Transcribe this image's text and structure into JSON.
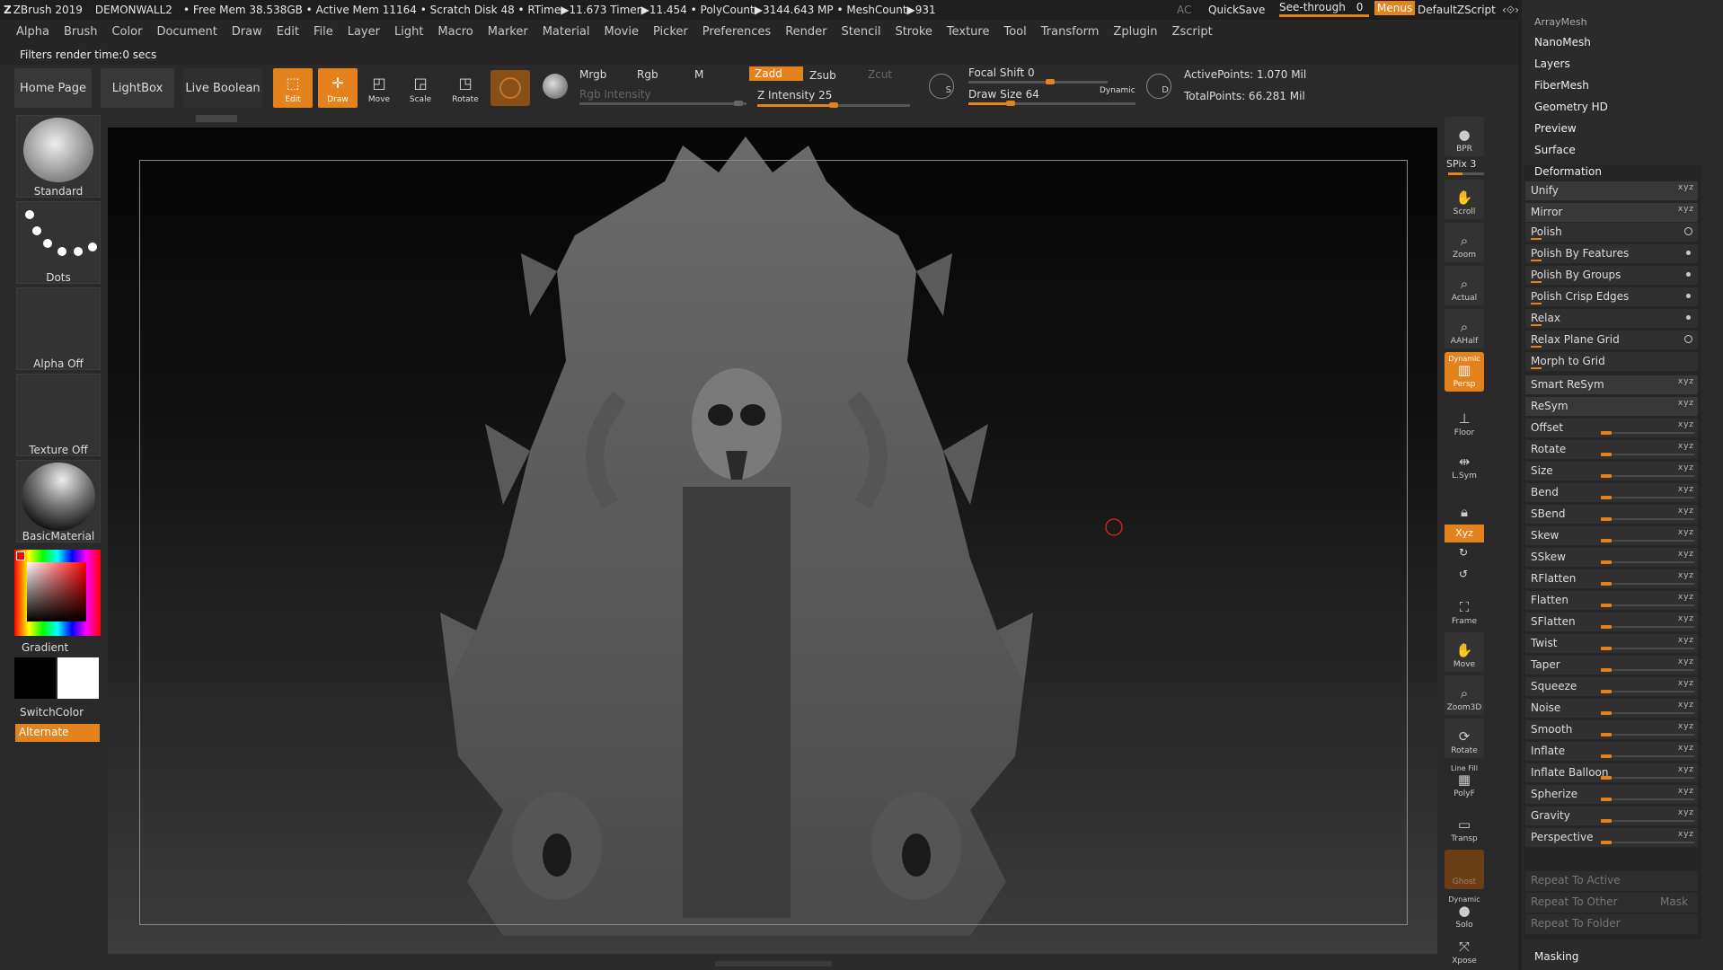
{
  "titlebar": {
    "app": "ZBrush 2019",
    "doc": "DEMONWALL2",
    "stats": "• Free Mem 38.538GB • Active Mem 11164 • Scratch Disk 48 • RTime▶11.673 Timer▶11.454 • PolyCount▶3144.643 MP • MeshCount▶931",
    "ac": "AC",
    "quicksave": "QuickSave",
    "seethrough": "See-through",
    "seethrough_value": "0",
    "menus": "Menus",
    "script": "DefaultZScript"
  },
  "menubar": [
    "Alpha",
    "Brush",
    "Color",
    "Document",
    "Draw",
    "Edit",
    "File",
    "Layer",
    "Light",
    "Macro",
    "Marker",
    "Material",
    "Movie",
    "Picker",
    "Preferences",
    "Render",
    "Stencil",
    "Stroke",
    "Texture",
    "Tool",
    "Transform",
    "Zplugin",
    "Zscript"
  ],
  "filter_status": "Filters render time:0 secs",
  "toolbar": {
    "home_page": "Home Page",
    "lightbox": "LightBox",
    "live_boolean": "Live Boolean",
    "edit": "Edit",
    "draw": "Draw",
    "move": "Move",
    "scale": "Scale",
    "rotate": "Rotate",
    "mrgb": "Mrgb",
    "rgb": "Rgb",
    "m": "M",
    "zadd": "Zadd",
    "zsub": "Zsub",
    "zcut": "Zcut",
    "rgb_intensity": "Rgb Intensity",
    "z_intensity_label": "Z Intensity",
    "z_intensity": "25",
    "focal_shift_label": "Focal Shift",
    "focal_shift": "0",
    "draw_size_label": "Draw Size",
    "draw_size": "64",
    "dynamic": "Dynamic",
    "active_points": "ActivePoints: 1.070 Mil",
    "total_points": "TotalPoints: 66.281 Mil",
    "s_label": "S",
    "d_label": "D"
  },
  "left_shelf": {
    "brush": "Standard",
    "stroke": "Dots",
    "alpha": "Alpha Off",
    "texture": "Texture Off",
    "material": "BasicMaterial",
    "gradient": "Gradient",
    "switchcolor": "SwitchColor",
    "alternate": "Alternate",
    "primary_color": "#ff0000",
    "main_color": "#000000",
    "secondary_color": "#ffffff"
  },
  "right_shelf": {
    "bpr": "BPR",
    "spix": "SPix 3",
    "scroll": "Scroll",
    "zoom": "Zoom",
    "actual": "Actual",
    "aahalf": "AAHalf",
    "persp_top": "Dynamic",
    "persp": "Persp",
    "floor": "Floor",
    "lsym": "L.Sym",
    "xyz": "Xyz",
    "frame": "Frame",
    "move": "Move",
    "zoom3d": "Zoom3D",
    "rotate": "Rotate",
    "linefill": "Line Fill",
    "polyf": "PolyF",
    "transp": "Transp",
    "ghost": "Ghost",
    "solo_top": "Dynamic",
    "solo": "Solo",
    "xpose": "Xpose"
  },
  "tray": {
    "top_cut": "ArrayMesh",
    "sections": [
      "NanoMesh",
      "Layers",
      "FiberMesh",
      "Geometry HD",
      "Preview",
      "Surface"
    ],
    "deformation": "Deformation",
    "rows": [
      {
        "name": "Unify",
        "kind": "xyz"
      },
      {
        "name": "Mirror",
        "kind": "xyz"
      },
      {
        "name": "Polish",
        "kind": "circle"
      },
      {
        "name": "Polish By Features",
        "kind": "dot"
      },
      {
        "name": "Polish By Groups",
        "kind": "dot"
      },
      {
        "name": "Polish Crisp Edges",
        "kind": "dot"
      },
      {
        "name": "Relax",
        "kind": "dot"
      },
      {
        "name": "Relax Plane Grid",
        "kind": "circle"
      },
      {
        "name": "Morph to Grid",
        "kind": "none"
      },
      {
        "name": "Smart ReSym",
        "kind": "xyz"
      },
      {
        "name": "ReSym",
        "kind": "xyz"
      },
      {
        "name": "Offset",
        "kind": "slider"
      },
      {
        "name": "Rotate",
        "kind": "slider"
      },
      {
        "name": "Size",
        "kind": "slider"
      },
      {
        "name": "Bend",
        "kind": "slider"
      },
      {
        "name": "SBend",
        "kind": "slider"
      },
      {
        "name": "Skew",
        "kind": "slider"
      },
      {
        "name": "SSkew",
        "kind": "slider"
      },
      {
        "name": "RFlatten",
        "kind": "slider"
      },
      {
        "name": "Flatten",
        "kind": "slider"
      },
      {
        "name": "SFlatten",
        "kind": "slider"
      },
      {
        "name": "Twist",
        "kind": "slider"
      },
      {
        "name": "Taper",
        "kind": "slider"
      },
      {
        "name": "Squeeze",
        "kind": "slider"
      },
      {
        "name": "Noise",
        "kind": "slider"
      },
      {
        "name": "Smooth",
        "kind": "slider"
      },
      {
        "name": "Inflate",
        "kind": "slider"
      },
      {
        "name": "Inflate Balloon",
        "kind": "slider"
      },
      {
        "name": "Spherize",
        "kind": "slider"
      },
      {
        "name": "Gravity",
        "kind": "slider"
      },
      {
        "name": "Perspective",
        "kind": "slider"
      }
    ],
    "xyz_mark": "x y z",
    "repeat_active": "Repeat To Active",
    "repeat_other": "Repeat To Other",
    "mask": "Mask",
    "repeat_folder": "Repeat To Folder",
    "masking": "Masking"
  },
  "colors": {
    "accent": "#e4831d"
  }
}
